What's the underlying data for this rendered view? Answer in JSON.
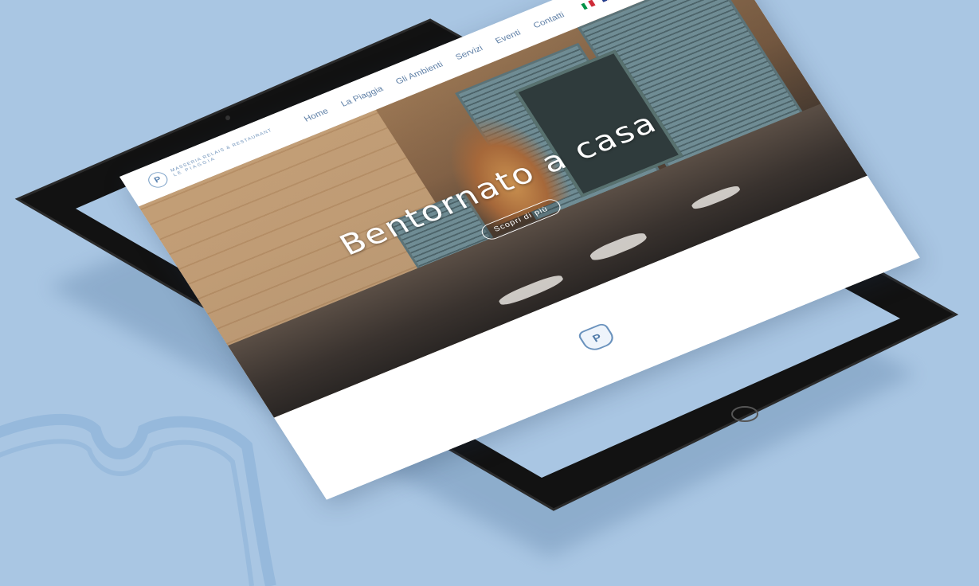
{
  "site": {
    "brand": {
      "line1": "MASSERIA RELAIS & RESTAURANT",
      "line2": "LE PIAGGIA",
      "mark": "P"
    },
    "nav": [
      "Home",
      "La Piaggia",
      "Gli Ambienti",
      "Servizi",
      "Eventi",
      "Contatti"
    ],
    "languages": [
      "it-flag-icon",
      "uk-flag-icon"
    ],
    "hero": {
      "title": "Bentornato a casa",
      "button": "Scopri di più"
    },
    "footer": {
      "mark": "P"
    }
  },
  "colors": {
    "background": "#a9c6e3",
    "accent": "#5e7fa6",
    "tablet_frame": "#141414"
  }
}
